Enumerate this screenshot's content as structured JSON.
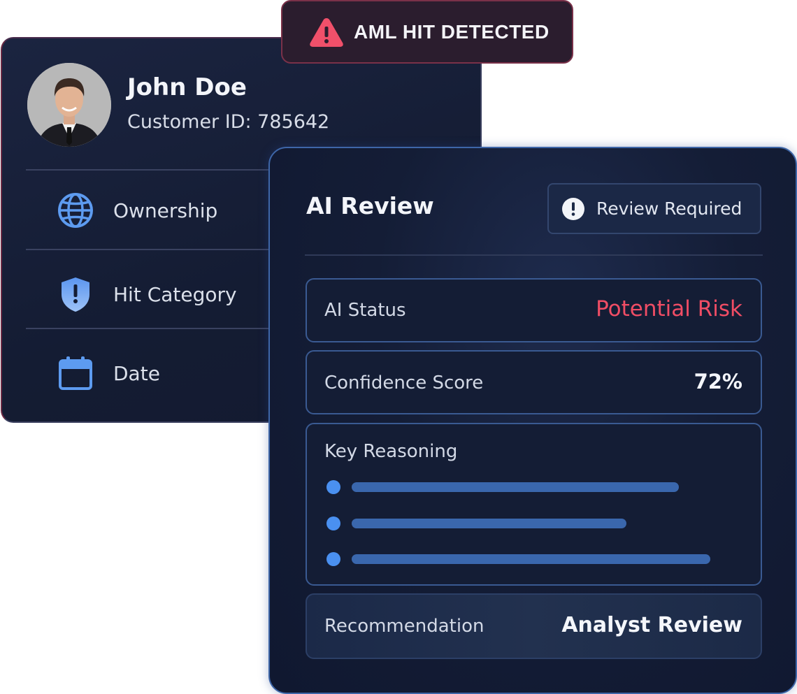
{
  "customer": {
    "name": "John Doe",
    "customer_id": "Customer ID: 785642",
    "avatar_icon": "person-avatar",
    "fields": [
      {
        "label": "Ownership",
        "icon": "globe-icon"
      },
      {
        "label": "Hit Category",
        "icon": "shield-alert-icon"
      },
      {
        "label": "Date",
        "icon": "calendar-icon"
      }
    ]
  },
  "alert": {
    "text": "AML HIT DETECTED",
    "icon": "warning-triangle-icon",
    "color": "#f0506a"
  },
  "review": {
    "title": "AI Review",
    "badge_text": "Review Required",
    "badge_icon": "exclamation-circle-icon",
    "status": {
      "label": "AI Status",
      "value": "Potential Risk",
      "color": "#f04d65"
    },
    "confidence": {
      "label": "Confidence Score",
      "value": "72%"
    },
    "reasoning": {
      "label": "Key Reasoning",
      "items_count_shown": 3
    },
    "recommendation": {
      "label": "Recommendation",
      "value": "Analyst Review"
    }
  },
  "colors": {
    "card_background": "#141c33",
    "accent_blue": "#4a90f0",
    "bar_blue": "#3a67ad",
    "alert_red": "#f04d65"
  }
}
